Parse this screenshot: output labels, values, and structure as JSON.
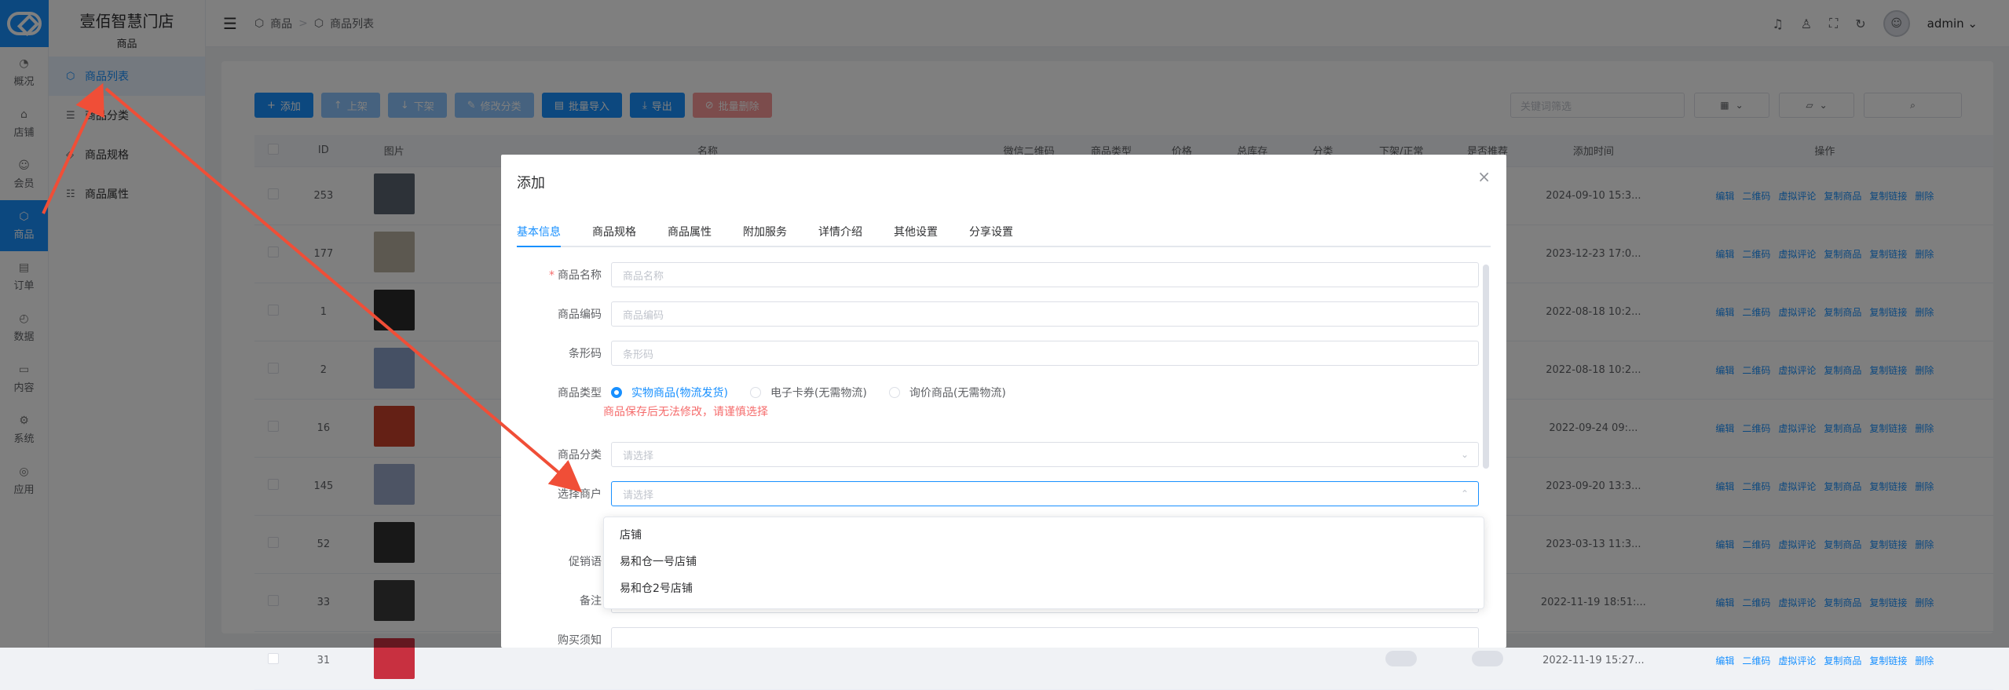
{
  "rail": {
    "items": [
      {
        "icon": "dashboard-icon",
        "glyph": "◔",
        "label": "概况"
      },
      {
        "icon": "store-icon",
        "glyph": "⌂",
        "label": "店铺"
      },
      {
        "icon": "user-icon",
        "glyph": "☺",
        "label": "会员"
      },
      {
        "icon": "goods-icon",
        "glyph": "⬡",
        "label": "商品"
      },
      {
        "icon": "order-icon",
        "glyph": "▤",
        "label": "订单"
      },
      {
        "icon": "data-icon",
        "glyph": "◴",
        "label": "数据"
      },
      {
        "icon": "content-icon",
        "glyph": "▭",
        "label": "内容"
      },
      {
        "icon": "system-icon",
        "glyph": "⚙",
        "label": "系统"
      },
      {
        "icon": "app-icon",
        "glyph": "◎",
        "label": "应用"
      }
    ]
  },
  "sidebar": {
    "brand": "壹佰智慧门店",
    "section": "商品",
    "items": [
      {
        "icon": "cube-icon",
        "glyph": "⬡",
        "label": "商品列表"
      },
      {
        "icon": "list-icon",
        "glyph": "☰",
        "label": "商品分类"
      },
      {
        "icon": "tag-icon",
        "glyph": "◈",
        "label": "商品规格"
      },
      {
        "icon": "sliders-icon",
        "glyph": "☷",
        "label": "商品属性"
      }
    ]
  },
  "header": {
    "breadcrumb": [
      "商品",
      "商品列表"
    ],
    "username": "admin"
  },
  "toolbar": {
    "buttons": [
      {
        "glyph": "+",
        "label": "添加"
      },
      {
        "glyph": "↑",
        "label": "上架"
      },
      {
        "glyph": "↓",
        "label": "下架"
      },
      {
        "glyph": "✎",
        "label": "修改分类"
      },
      {
        "glyph": "▤",
        "label": "批量导入"
      },
      {
        "glyph": "⤓",
        "label": "导出"
      },
      {
        "glyph": "⊘",
        "label": "批量删除"
      }
    ],
    "keyword_placeholder": "关键词筛选"
  },
  "table": {
    "columns": [
      "ID",
      "图片",
      "名称",
      "微信二维码",
      "商品类型",
      "价格",
      "总库存",
      "分类",
      "下架/正常",
      "是否推荐",
      "添加时间",
      "操作"
    ],
    "rows": [
      {
        "id": "253",
        "date": "2024-09-10 15:3..."
      },
      {
        "id": "177",
        "date": "2023-12-23 17:0..."
      },
      {
        "id": "1",
        "date": "2022-08-18 10:2..."
      },
      {
        "id": "2",
        "date": "2022-08-18 10:2..."
      },
      {
        "id": "16",
        "date": "2022-09-24 09:..."
      },
      {
        "id": "145",
        "date": "2023-09-20 13:3..."
      },
      {
        "id": "52",
        "date": "2023-03-13 11:3..."
      },
      {
        "id": "33",
        "date": "2022-11-19 18:51:..."
      },
      {
        "id": "31",
        "date": "2022-11-19 15:27..."
      }
    ],
    "ops": [
      "编辑",
      "二维码",
      "虚拟评论",
      "复制商品",
      "复制链接",
      "删除"
    ]
  },
  "modal": {
    "title": "添加",
    "tabs": [
      "基本信息",
      "商品规格",
      "商品属性",
      "附加服务",
      "详情介绍",
      "其他设置",
      "分享设置"
    ],
    "fields": {
      "name_label": "商品名称",
      "name_placeholder": "商品名称",
      "code_label": "商品编码",
      "code_placeholder": "商品编码",
      "barcode_label": "条形码",
      "barcode_placeholder": "条形码",
      "type_label": "商品类型",
      "type_options": [
        "实物商品(物流发货)",
        "电子卡券(无需物流)",
        "询价商品(无需物流)"
      ],
      "type_warning": "商品保存后无法修改，请谨慎选择",
      "category_label": "商品分类",
      "category_placeholder": "请选择",
      "merchant_label": "选择商户",
      "merchant_placeholder": "请选择",
      "promo_label": "促销语",
      "remark_label": "备注",
      "notice_label": "购买须知"
    },
    "merchant_options": [
      "店铺",
      "易和仓一号店铺",
      "易和仓2号店铺"
    ]
  },
  "colors": {
    "primary": "#1890ff",
    "danger": "#f56c6c",
    "annotation": "#f04e37"
  }
}
